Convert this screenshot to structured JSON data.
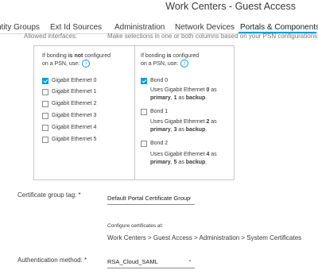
{
  "header": {
    "app_title": "Work Centers - Guest Access",
    "tabs": [
      {
        "label": "ntity Groups"
      },
      {
        "label": "Ext Id Sources"
      },
      {
        "label": "Administration"
      },
      {
        "label": "Network Devices"
      },
      {
        "label": "Portals & Components",
        "active": true
      }
    ],
    "accent": "#049fd9"
  },
  "cutoff": {
    "left_label": "Allowed interfaces:",
    "right_text": "Make selections in one or both columns based on your PSN configurations."
  },
  "interfaces": {
    "left_heading": {
      "part1": "If bonding ",
      "bold": "is not",
      "part2": " configured",
      "line2": "on a PSN, use:"
    },
    "right_heading": {
      "part1": "If bonding ",
      "bold": "is",
      "part2": " configured",
      "line2": "on a PSN, use:"
    },
    "left_options": [
      {
        "label": "Gigabit Ethernet 0",
        "checked": true
      },
      {
        "label": "Gigabit Ethernet 1",
        "checked": false
      },
      {
        "label": "Gigabit Ethernet 2",
        "checked": false
      },
      {
        "label": "Gigabit Ethernet 3",
        "checked": false
      },
      {
        "label": "Gigabit Ethernet 4",
        "checked": false
      },
      {
        "label": "Gigabit Ethernet 5",
        "checked": false
      }
    ],
    "right_options": [
      {
        "label": "Bond 0",
        "checked": true,
        "desc": {
          "a": "Uses Gigabit Ethernet ",
          "b": "0",
          "c": " as",
          "d": "primary",
          "e": ", ",
          "f": "1",
          "g": " as ",
          "h": "backup",
          "i": "."
        }
      },
      {
        "label": "Bond 1",
        "checked": false,
        "desc": {
          "a": "Uses Gigabit Ethernet ",
          "b": "2",
          "c": " as",
          "d": "primary",
          "e": ", ",
          "f": "3",
          "g": " as ",
          "h": "backup",
          "i": "."
        }
      },
      {
        "label": "Bond 2",
        "checked": false,
        "desc": {
          "a": "Uses Gigabit Ethernet ",
          "b": "4",
          "c": " as",
          "d": "primary",
          "e": ", ",
          "f": "5",
          "g": " as ",
          "h": "backup",
          "i": "."
        }
      }
    ]
  },
  "certificate": {
    "label": "Certificate group tag: *",
    "value": "Default Portal Certificate Group",
    "configure_text": "Configure certificates at:",
    "path": "Work Centers > Guest Access > Administration > System Certificates"
  },
  "authentication": {
    "label": "Authentication method: *",
    "value": "RSA_Cloud_SAML"
  }
}
